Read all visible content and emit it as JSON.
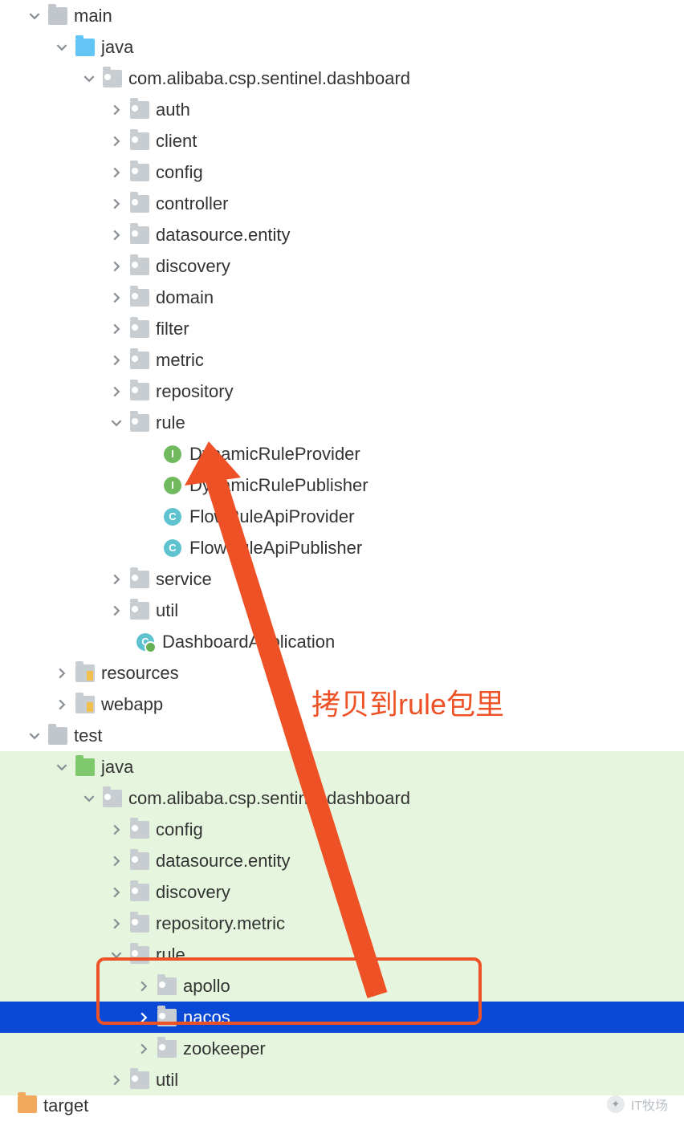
{
  "tree": {
    "main": "main",
    "java": "java",
    "dashboard": "com.alibaba.csp.sentinel.dashboard",
    "auth": "auth",
    "client": "client",
    "config": "config",
    "controller": "controller",
    "datasource_entity": "datasource.entity",
    "discovery": "discovery",
    "domain": "domain",
    "filter": "filter",
    "metric": "metric",
    "repository": "repository",
    "rule": "rule",
    "DynamicRuleProvider": "DynamicRuleProvider",
    "DynamicRulePublisher": "DynamicRulePublisher",
    "FlowRuleApiProvider": "FlowRuleApiProvider",
    "FlowRuleApiPublisher": "FlowRuleApiPublisher",
    "service": "service",
    "util": "util",
    "DashboardApplication": "DashboardApplication",
    "resources": "resources",
    "webapp": "webapp",
    "test": "test",
    "test_java": "java",
    "test_dashboard": "com.alibaba.csp.sentinel.dashboard",
    "test_config": "config",
    "test_datasource_entity": "datasource.entity",
    "test_discovery": "discovery",
    "test_repository_metric": "repository.metric",
    "test_rule": "rule",
    "apollo": "apollo",
    "nacos": "nacos",
    "zookeeper": "zookeeper",
    "test_util": "util",
    "target": "target"
  },
  "annotation": "拷贝到rule包里",
  "watermark": "IT牧场"
}
